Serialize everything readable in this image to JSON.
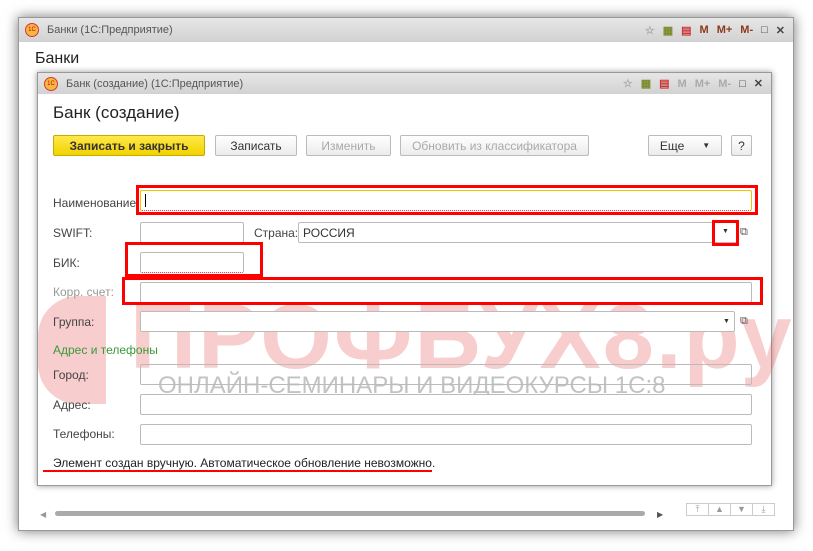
{
  "outer_window": {
    "title": "Банки  (1С:Предприятие)",
    "heading": "Банки"
  },
  "toolbar_icons": {
    "m": "M",
    "m_plus": "M+",
    "m_minus": "M-",
    "maximize": "□",
    "close": "✕"
  },
  "dialog": {
    "title": "Банк (создание)  (1С:Предприятие)",
    "heading": "Банк (создание)"
  },
  "buttons": {
    "save_close": "Записать и закрыть",
    "save": "Записать",
    "edit": "Изменить",
    "update": "Обновить из классификатора",
    "more": "Еще",
    "help": "?"
  },
  "fields": {
    "name_label": "Наименование:",
    "swift_label": "SWIFT:",
    "country_label": "Страна:",
    "country_value": "РОССИЯ",
    "bik_label": "БИК:",
    "corr_label": "Корр. счет:",
    "group_label": "Группа:",
    "section": "Адрес и телефоны",
    "city_label": "Город:",
    "address_label": "Адрес:",
    "phones_label": "Телефоны:"
  },
  "message": "Элемент создан вручную. Автоматическое обновление невозможно.",
  "watermark": {
    "title": "ПРОФБУХ8.ру",
    "subtitle": "ОНЛАЙН-СЕМИНАРЫ И ВИДЕОКУРСЫ 1С:8"
  },
  "colors": {
    "accent": "#f2d200",
    "highlight": "#ff0000",
    "section": "#3a9a3a"
  }
}
